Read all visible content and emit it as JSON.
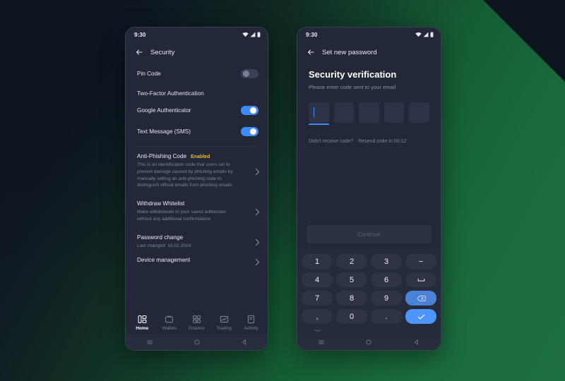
{
  "theme": {
    "bg_dark_navy": "#0e1420",
    "bg_green": "#1d7041",
    "phone_bg": "#232838",
    "accent_blue": "#3d8bfd",
    "accent_blue_bright": "#4d95fb",
    "badge_yellow": "#e8b931",
    "text_primary": "#e9ecf4",
    "text_muted": "#7d8396"
  },
  "left_phone": {
    "status": {
      "time": "9:30",
      "icons": [
        "wifi-icon",
        "cellular-signal-icon",
        "battery-icon"
      ]
    },
    "appbar": {
      "back_icon": "back-arrow-icon",
      "title": "Security"
    },
    "pin_code": {
      "label": "Pin Code",
      "enabled": false
    },
    "two_factor_heading": "Two-Factor Authentication",
    "two_factor_items": [
      {
        "label": "Google Authenticator",
        "enabled": true
      },
      {
        "label": "Text Message (SMS)",
        "enabled": true
      }
    ],
    "settings_items": [
      {
        "title": "Anti-Phishing Code",
        "badge": "Enabled",
        "description": "This is an identification code that users set to prevent damage caused by phishing emails by manually setting an anti-phishing code to distinguish official emails from phishing emails",
        "chevron": "chevron-right-icon"
      },
      {
        "title": "Withdraw Whitelist",
        "badge": "",
        "description": "Make withdrawals to your saved addresses without any additional confirmations",
        "chevron": "chevron-right-icon"
      },
      {
        "title": "Password change",
        "badge": "",
        "description": "Last changed: 15.02.2024",
        "chevron": "chevron-right-icon"
      },
      {
        "title": "Device management",
        "badge": "",
        "description": "",
        "chevron": "chevron-right-icon"
      }
    ],
    "tabs": [
      {
        "label": "Home",
        "icon": "dashboard-icon",
        "active": true
      },
      {
        "label": "Wallets",
        "icon": "wallet-icon",
        "active": false
      },
      {
        "label": "Finance",
        "icon": "grid-icon",
        "active": false
      },
      {
        "label": "Trading",
        "icon": "chart-icon",
        "active": false
      },
      {
        "label": "Activity",
        "icon": "document-icon",
        "active": false
      }
    ],
    "navbar": [
      "menu-icon",
      "home-circle-icon",
      "back-triangle-icon"
    ]
  },
  "right_phone": {
    "status": {
      "time": "9:30",
      "icons": [
        "wifi-icon",
        "cellular-signal-icon",
        "battery-icon"
      ]
    },
    "appbar": {
      "back_icon": "back-arrow-icon",
      "title": "Set new password"
    },
    "title": "Security verification",
    "subtitle": "Please enter code sent to your email",
    "otp": {
      "length": 5,
      "values": [
        "",
        "",
        "",
        "",
        ""
      ],
      "active_index": 0
    },
    "resend": {
      "question": "Didn't receive code?",
      "action": "Resend code in 00:12"
    },
    "continue_button": {
      "label": "Continue",
      "disabled": true
    },
    "keypad": [
      {
        "label": "1",
        "name": "key-1",
        "style": "dim"
      },
      {
        "label": "2",
        "name": "key-2",
        "style": "dim"
      },
      {
        "label": "3",
        "name": "key-3",
        "style": "dim"
      },
      {
        "label": "−",
        "name": "key-minus",
        "style": "dim"
      },
      {
        "label": "4",
        "name": "key-4",
        "style": "dim"
      },
      {
        "label": "5",
        "name": "key-5",
        "style": "dim"
      },
      {
        "label": "6",
        "name": "key-6",
        "style": "dim"
      },
      {
        "label": "⌴",
        "name": "key-space",
        "style": "dim"
      },
      {
        "label": "7",
        "name": "key-7",
        "style": "dim"
      },
      {
        "label": "8",
        "name": "key-8",
        "style": "dim"
      },
      {
        "label": "9",
        "name": "key-9",
        "style": "dim"
      },
      {
        "label": "",
        "name": "key-backspace",
        "style": "blue-soft",
        "icon": "backspace-icon"
      },
      {
        "label": ",",
        "name": "key-comma",
        "style": "dim"
      },
      {
        "label": "0",
        "name": "key-0",
        "style": "dim"
      },
      {
        "label": ".",
        "name": "key-period",
        "style": "dim"
      },
      {
        "label": "",
        "name": "key-confirm",
        "style": "blue-bright",
        "icon": "checkmark-icon"
      }
    ],
    "keyboard_hide_icon": "chevron-down-icon",
    "navbar": [
      "menu-icon",
      "home-circle-icon",
      "back-triangle-icon"
    ]
  }
}
